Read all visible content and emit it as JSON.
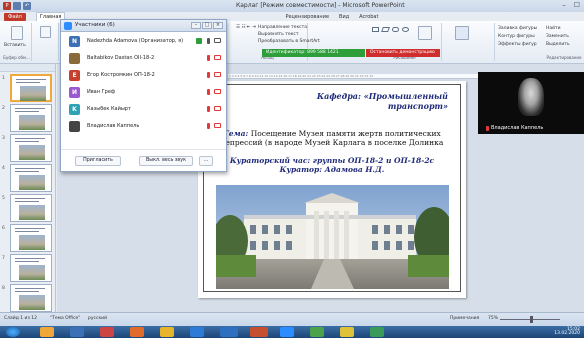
{
  "window": {
    "title": "Карлаг [Режим совместимости] - Microsoft PowerPoint",
    "controls": [
      "–",
      "☐"
    ]
  },
  "qat": [
    "P",
    "",
    "↶"
  ],
  "ribbon_tabs": {
    "file": "Файл",
    "home": "Главная",
    "others": [
      "Рецензирование",
      "Вид",
      "Acrobat"
    ]
  },
  "ribbon": {
    "paste": "Вставить",
    "create_slide": "Создать слайд",
    "groups": [
      "Буфер обм...",
      "Абзац",
      "Рисование",
      "Редактирование"
    ],
    "text_direction": "Направление текста",
    "align_text": "Выровнять текст",
    "convert_smartart": "Преобразовать в SmartArt",
    "arrange": "Упорядочить",
    "quick_styles": "Экспресс-стили",
    "shape_fill": "Заливка фигуры",
    "shape_outline": "Контур фигуры",
    "shape_effects": "Эффекты фигур",
    "find": "Найти",
    "replace": "Заменить",
    "select": "Выделить"
  },
  "meeting_bar": {
    "id_label": "Идентификатор: 899 588 1421",
    "stop_label": "Остановить демонстрацию"
  },
  "participants": {
    "title": "Участники (6)",
    "controls": [
      "–",
      "□",
      "×"
    ],
    "people": [
      {
        "initial": "N",
        "name": "Nadezhda Adamova (Организатор, я)",
        "color": "#3b6fb6"
      },
      {
        "initial": "",
        "name": "Baltabikov Dastan OII-18-2",
        "color": "#8a6a3a"
      },
      {
        "initial": "E",
        "name": "Егор Костромкин ОП-18-2",
        "color": "#c7402d"
      },
      {
        "initial": "И",
        "name": "Иван Греф",
        "color": "#9b59d0"
      },
      {
        "initial": "K",
        "name": "Казыбек Кайырт",
        "color": "#2fa3b5"
      },
      {
        "initial": "",
        "name": "Владислав Каппель",
        "color": "#444444"
      }
    ],
    "buttons": [
      "Пригласить",
      "Выкл. весь звук",
      "..."
    ]
  },
  "slide": {
    "kafedra_label": "Кафедра:",
    "kafedra_value": "«Промышленный транспорт»",
    "theme_label": "Тема:",
    "theme_text": "Посещение Музея памяти жертв политических репрессий (в народе Музей Карлага в поселке Долинка",
    "hour_text": "Кураторский час: группы ОП-18-2 и ОП-18-2с",
    "curator_text": "Куратор: Адамова Н.Д."
  },
  "slide_numbers": [
    "1",
    "2",
    "3",
    "4",
    "5",
    "6",
    "7",
    "8"
  ],
  "video": {
    "name": "Владислав Каппель"
  },
  "status": {
    "slide_info": "Слайд 1 из 12",
    "theme": "\"Тема Office\"",
    "lang": "русский",
    "notes": "Примечания",
    "zoom": "75%"
  },
  "taskbar": {
    "time": "15:02",
    "date": "13.02.2020"
  },
  "colors": {
    "accent_blue": "#1f2a7a",
    "zoom_green": "#2e9e3a",
    "zoom_red": "#cf2e2e",
    "file_tab": "#c0392b"
  }
}
